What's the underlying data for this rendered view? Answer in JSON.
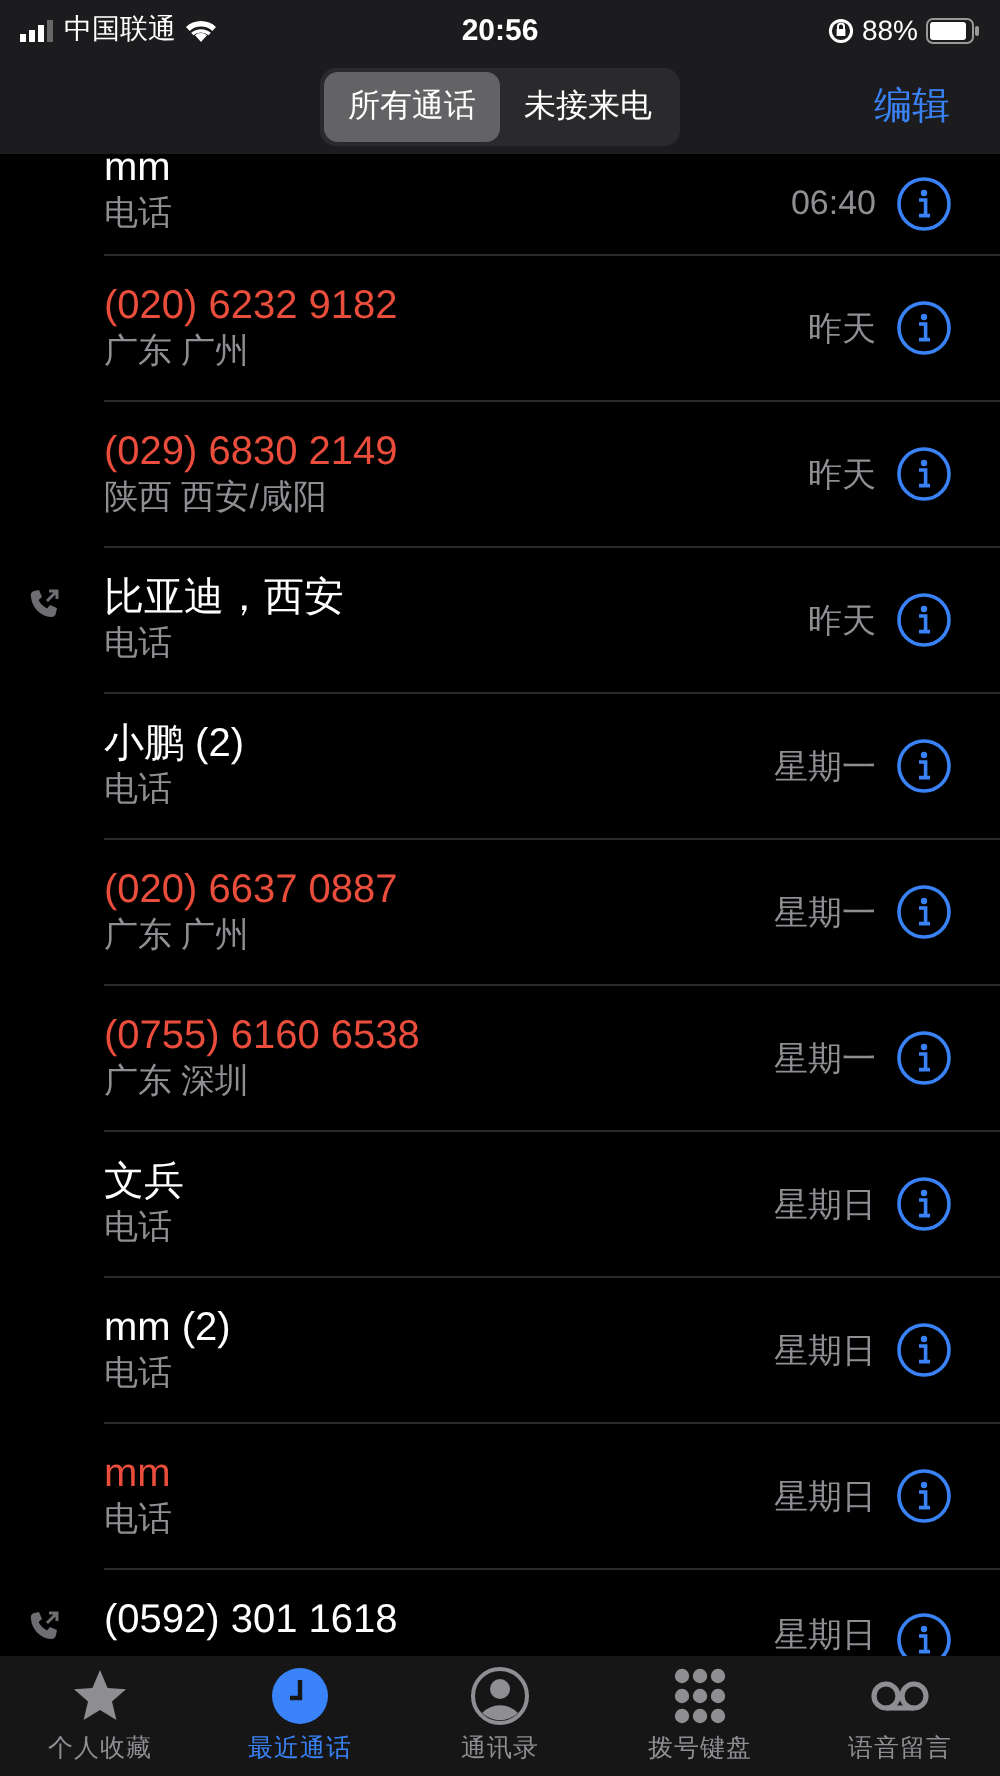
{
  "status_bar": {
    "carrier": "中国联通",
    "time": "20:56",
    "battery": "88%"
  },
  "header": {
    "segments": [
      {
        "label": "所有通话",
        "selected": true
      },
      {
        "label": "未接来电",
        "selected": false
      }
    ],
    "edit": "编辑"
  },
  "calls": [
    {
      "name": "mm",
      "subtitle": "电话",
      "time": "06:40",
      "missed": false,
      "outgoing": false
    },
    {
      "name": "(020) 6232 9182",
      "subtitle": "广东 广州",
      "time": "昨天",
      "missed": true,
      "outgoing": false
    },
    {
      "name": "(029) 6830 2149",
      "subtitle": "陕西 西安/咸阳",
      "time": "昨天",
      "missed": true,
      "outgoing": false
    },
    {
      "name": "比亚迪，西安",
      "subtitle": "电话",
      "time": "昨天",
      "missed": false,
      "outgoing": true
    },
    {
      "name": "小鹏 (2)",
      "subtitle": "电话",
      "time": "星期一",
      "missed": false,
      "outgoing": false
    },
    {
      "name": "(020) 6637 0887",
      "subtitle": "广东 广州",
      "time": "星期一",
      "missed": true,
      "outgoing": false
    },
    {
      "name": "(0755) 6160 6538",
      "subtitle": "广东 深圳",
      "time": "星期一",
      "missed": true,
      "outgoing": false
    },
    {
      "name": "文兵",
      "subtitle": "电话",
      "time": "星期日",
      "missed": false,
      "outgoing": false
    },
    {
      "name": "mm (2)",
      "subtitle": "电话",
      "time": "星期日",
      "missed": false,
      "outgoing": false
    },
    {
      "name": "mm",
      "subtitle": "电话",
      "time": "星期日",
      "missed": true,
      "outgoing": false
    },
    {
      "name": "(0592) 301 1618",
      "time": "星期日",
      "missed": false,
      "outgoing": true
    }
  ],
  "tab_bar": [
    {
      "label": "个人收藏",
      "kind": "favorites",
      "selected": false
    },
    {
      "label": "最近通话",
      "kind": "recents",
      "selected": true
    },
    {
      "label": "通讯录",
      "kind": "contacts",
      "selected": false
    },
    {
      "label": "拨号键盘",
      "kind": "keypad",
      "selected": false
    },
    {
      "label": "语音留言",
      "kind": "voicemail",
      "selected": false
    }
  ]
}
